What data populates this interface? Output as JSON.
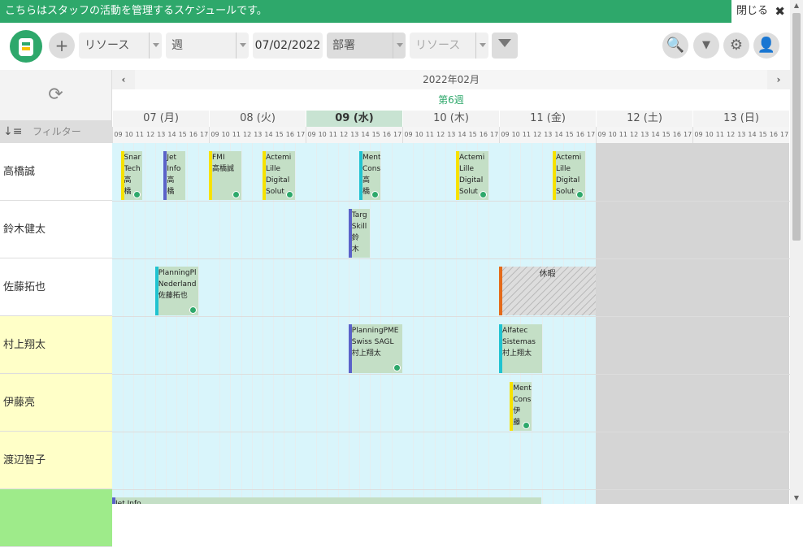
{
  "banner": {
    "text": "こちらはスタッフの活動を管理するスケジュールです。",
    "close_label": "閉じる",
    "close_icon": "✖"
  },
  "toolbar": {
    "add_icon": "+",
    "view_resource": "リソース",
    "view_period": "週",
    "date": "07/02/2022",
    "department": "部署",
    "resource_filter": "リソース",
    "search_icon": "🔍",
    "dropdown_icon": "▼",
    "settings_icon": "⚙",
    "user_icon": "👤"
  },
  "left": {
    "refresh_icon": "⟳",
    "sort_icon": "↓≡",
    "filter_placeholder": "フィルター"
  },
  "calendar": {
    "month": "2022年02月",
    "week": "第6週",
    "prev": "‹",
    "next": "›",
    "days": [
      "07 (月)",
      "08 (火)",
      "09 (水)",
      "10 (木)",
      "11 (金)",
      "12 (土)",
      "13 (日)"
    ],
    "hours": [
      "09",
      "10",
      "11",
      "12",
      "13",
      "14",
      "15",
      "16",
      "17"
    ]
  },
  "resources": [
    "高橋誠",
    "鈴木健太",
    "佐藤拓也",
    "村上翔太",
    "伊藤亮",
    "渡辺智子",
    ""
  ],
  "resource_colors": [
    "#ffffff",
    "#ffffff",
    "#ffffff",
    "#ffffc8",
    "#ffffc8",
    "#ffffc8",
    "#9eeb8a"
  ],
  "events": [
    {
      "row": 0,
      "day": 0,
      "h": 0.8,
      "w": 2.0,
      "color": "#f6e200",
      "text": "Snar\nTech\n高\n橋",
      "icon": true
    },
    {
      "row": 0,
      "day": 0,
      "h": 4.8,
      "w": 2.0,
      "color": "#5b62c9",
      "text": "Jet\nInfo\n高\n橋",
      "icon": false
    },
    {
      "row": 0,
      "day": 1,
      "h": 0.0,
      "w": 3.0,
      "color": "#f6e200",
      "text": "FMI\n高橋誠",
      "icon": true
    },
    {
      "row": 0,
      "day": 1,
      "h": 5.0,
      "w": 3.0,
      "color": "#f6e200",
      "text": "Actemi\nLille\nDigital\nSolut",
      "icon": true
    },
    {
      "row": 0,
      "day": 2,
      "h": 5.0,
      "w": 2.0,
      "color": "#20c3d0",
      "text": "Ment\nCons\n高\n橋",
      "icon": true
    },
    {
      "row": 0,
      "day": 3,
      "h": 5.0,
      "w": 3.0,
      "color": "#f6e200",
      "text": "Actemi\nLille\nDigital\nSolut",
      "icon": true
    },
    {
      "row": 0,
      "day": 4,
      "h": 5.0,
      "w": 3.0,
      "color": "#f6e200",
      "text": "Actemi\nLille\nDigital\nSolut",
      "icon": true
    },
    {
      "row": 1,
      "day": 2,
      "h": 4.0,
      "w": 2.0,
      "color": "#5b62c9",
      "text": "Targ\nSkill\n鈴\n木",
      "icon": false
    },
    {
      "row": 2,
      "day": 0,
      "h": 4.0,
      "w": 4.0,
      "color": "#20c3d0",
      "text": "PlanningPl\nNederland\n佐藤拓也",
      "icon": true
    },
    {
      "row": 3,
      "day": 2,
      "h": 4.0,
      "w": 5.0,
      "color": "#5b62c9",
      "text": "PlanningPME\nSwiss SAGL\n村上翔太",
      "icon": true
    },
    {
      "row": 3,
      "day": 4,
      "h": 0.0,
      "w": 4.0,
      "color": "#20c3d0",
      "text": "Alfatec\nSistemas\n村上翔太",
      "icon": false
    },
    {
      "row": 4,
      "day": 4,
      "h": 1.0,
      "w": 2.0,
      "color": "#f6e200",
      "text": "Ment\nCons\n伊\n藤",
      "icon": true
    },
    {
      "row": 6,
      "day": 0,
      "h": 0.0,
      "w": 40.0,
      "color": "#5b62c9",
      "text": "Jet Info",
      "icon": false
    }
  ],
  "holiday": {
    "row": 2,
    "day": 4,
    "label": "休暇"
  }
}
